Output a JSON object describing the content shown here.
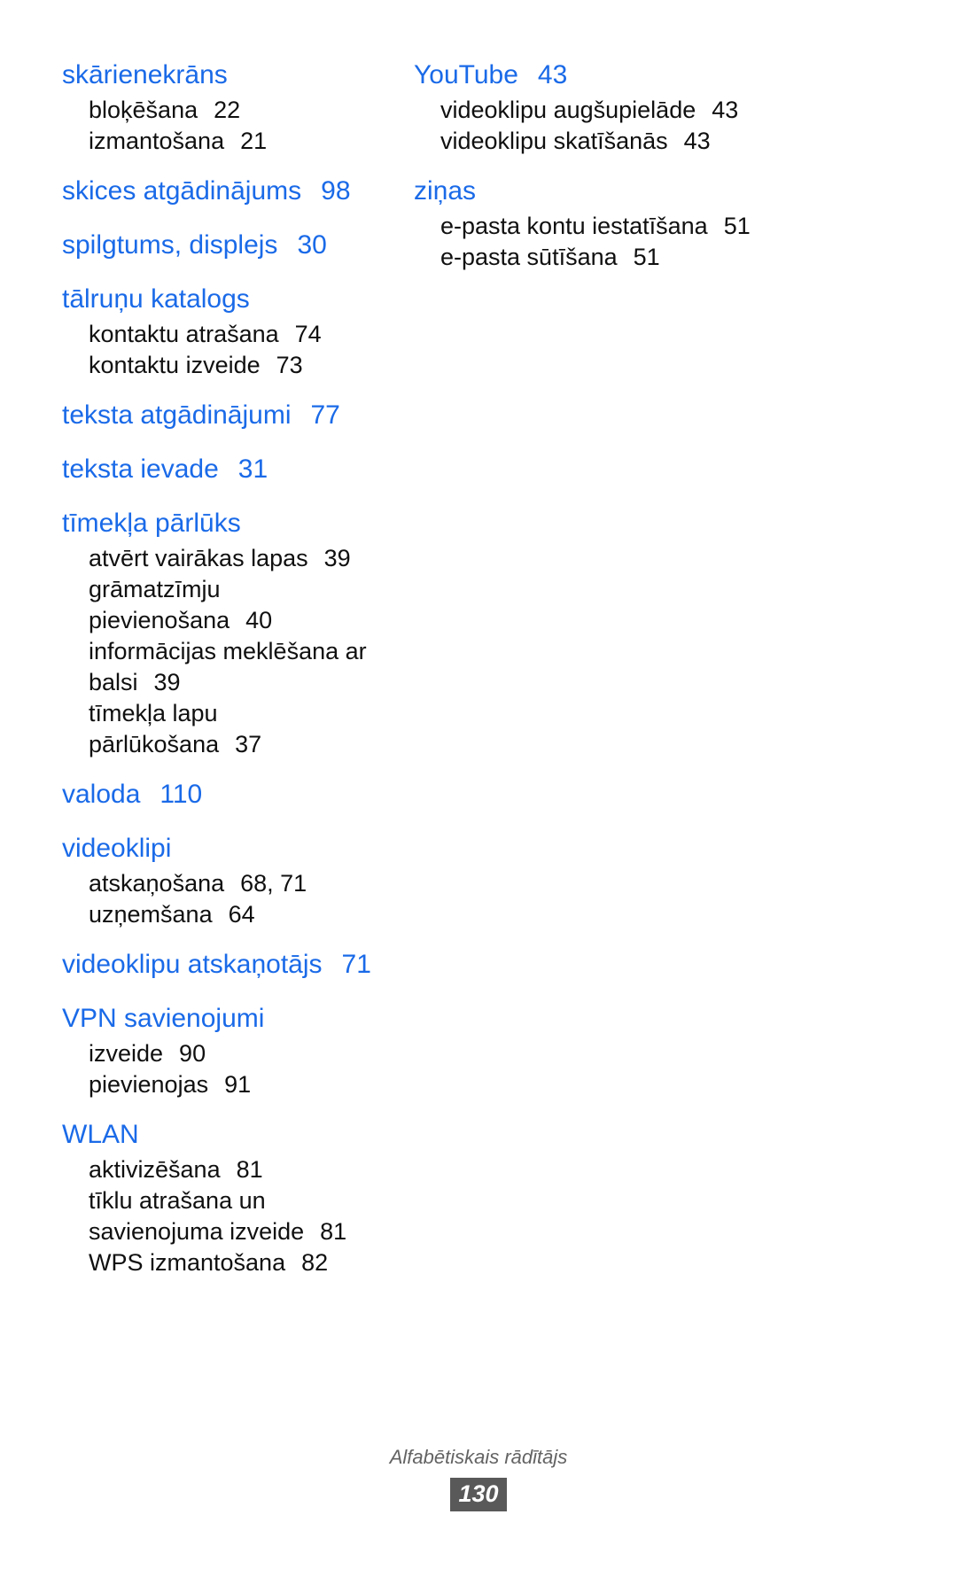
{
  "colors": {
    "heading_blue": "#1a6ae8",
    "body_black": "#101010",
    "footer_gray": "#636363",
    "badge_bg": "#595959",
    "badge_text": "#ffffff",
    "page_bg": "#ffffff"
  },
  "index": {
    "left_column": [
      {
        "heading": "skārienekrāns",
        "page": "",
        "entries": [
          {
            "label": "bloķēšana",
            "page": "22"
          },
          {
            "label": "izmantošana",
            "page": "21"
          }
        ]
      },
      {
        "heading": "skices atgādinājums",
        "page": "98",
        "entries": []
      },
      {
        "heading": "spilgtums, displejs",
        "page": "30",
        "entries": []
      },
      {
        "heading": "tālruņu katalogs",
        "page": "",
        "entries": [
          {
            "label": "kontaktu atrašana",
            "page": "74"
          },
          {
            "label": "kontaktu izveide",
            "page": "73"
          }
        ]
      },
      {
        "heading": "teksta atgādinājumi",
        "page": "77",
        "entries": []
      },
      {
        "heading": "teksta ievade",
        "page": "31",
        "entries": []
      },
      {
        "heading": "tīmekļa pārlūks",
        "page": "",
        "entries": [
          {
            "label": "atvērt vairākas lapas",
            "page": "39"
          },
          {
            "label": "grāmatzīmju pievienošana",
            "page": "40"
          },
          {
            "label": "informācijas meklēšana ar balsi",
            "page": "39"
          },
          {
            "label": "tīmekļa lapu pārlūkošana",
            "page": "37"
          }
        ]
      },
      {
        "heading": "valoda",
        "page": "110",
        "entries": []
      },
      {
        "heading": "videoklipi",
        "page": "",
        "entries": [
          {
            "label": "atskaņošana",
            "page": "68, 71"
          },
          {
            "label": "uzņemšana",
            "page": "64"
          }
        ]
      },
      {
        "heading": "videoklipu atskaņotājs",
        "page": "71",
        "entries": []
      },
      {
        "heading": "VPN savienojumi",
        "page": "",
        "entries": [
          {
            "label": "izveide",
            "page": "90"
          },
          {
            "label": "pievienojas",
            "page": "91"
          }
        ]
      },
      {
        "heading": "WLAN",
        "page": "",
        "entries": [
          {
            "label": "aktivizēšana",
            "page": "81"
          },
          {
            "label": "tīklu atrašana un savienojuma izveide",
            "page": "81"
          },
          {
            "label": "WPS izmantošana",
            "page": "82"
          }
        ]
      }
    ],
    "right_column": [
      {
        "heading": "YouTube",
        "page": "43",
        "entries": [
          {
            "label": "videoklipu augšupielāde",
            "page": "43"
          },
          {
            "label": "videoklipu skatīšanās",
            "page": "43"
          }
        ]
      },
      {
        "heading": "ziņas",
        "page": "",
        "entries": [
          {
            "label": "e-pasta kontu iestatīšana",
            "page": "51"
          },
          {
            "label": "e-pasta sūtīšana",
            "page": "51"
          }
        ]
      }
    ]
  },
  "footer": {
    "label": "Alfabētiskais rādītājs",
    "page_number": "130"
  }
}
